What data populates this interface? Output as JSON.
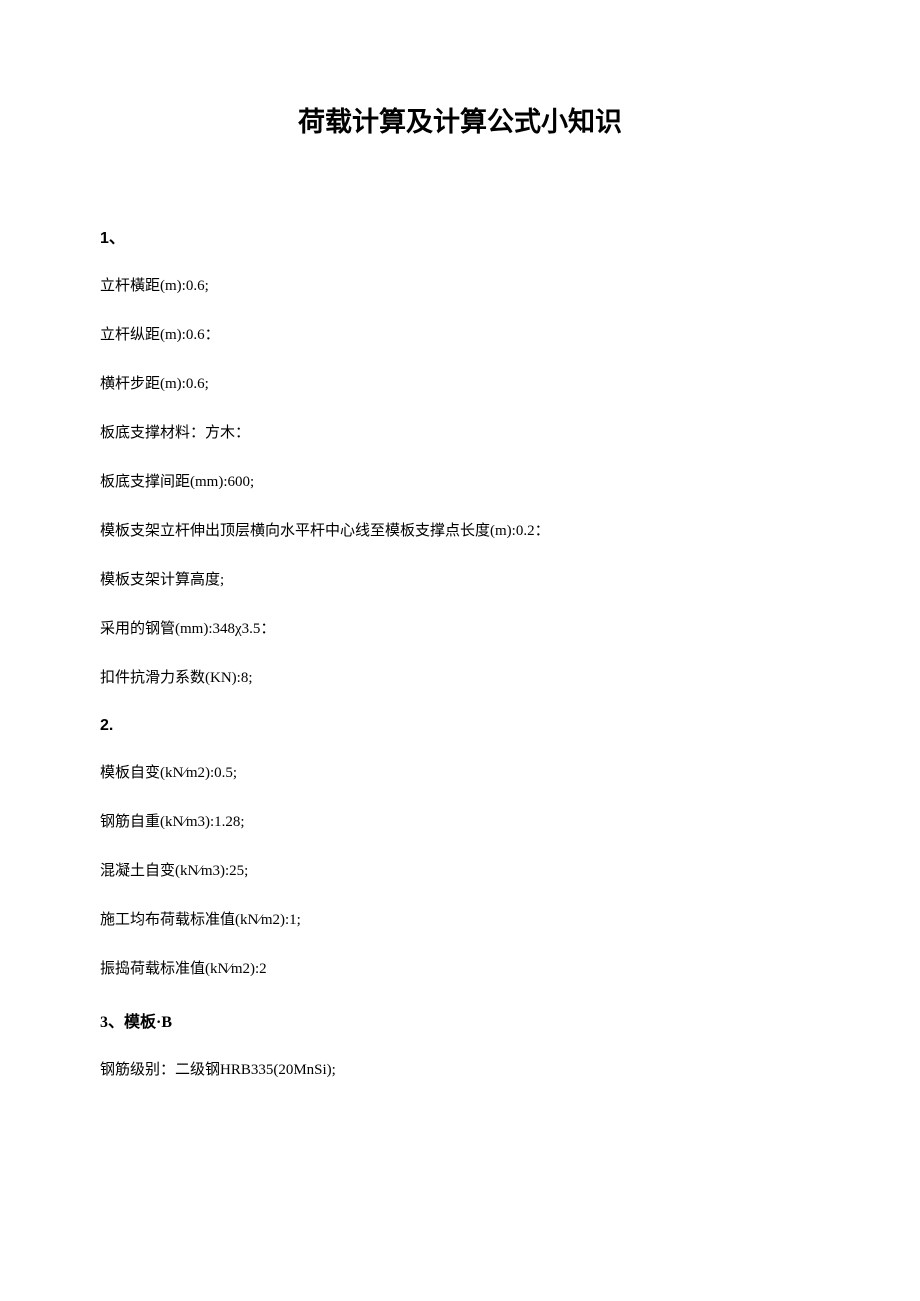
{
  "title": "荷载计算及计算公式小知识",
  "sections": [
    {
      "heading": "1、",
      "lines": [
        "立杆橫距(m):0.6;",
        "立杆纵距(m):0.6：",
        "横杆步距(m):0.6;",
        "板底支撑材料：方木：",
        "板底支撑间距(mm):600;",
        "模板支架立杆伸出顶层横向水平杆中心线至模板支撑点长度(m):0.2：",
        "模板支架计算高度;",
        "采用的钢管(mm):348χ3.5：",
        "扣件抗滑力系数(KN):8;"
      ]
    },
    {
      "heading": "2.",
      "lines": [
        "模板自变(kN⁄m2):0.5;",
        "钢筋自重(kN⁄m3):1.28;",
        "混凝土自变(kN⁄m3):25;",
        "施工均布荷载标准值(kN⁄m2):1;",
        "振捣荷载标准值(kN⁄m2):2"
      ]
    },
    {
      "heading": "3、模板·B",
      "lines": [
        "钢筋级别：二级钢HRB335(20MnSi);"
      ]
    }
  ]
}
